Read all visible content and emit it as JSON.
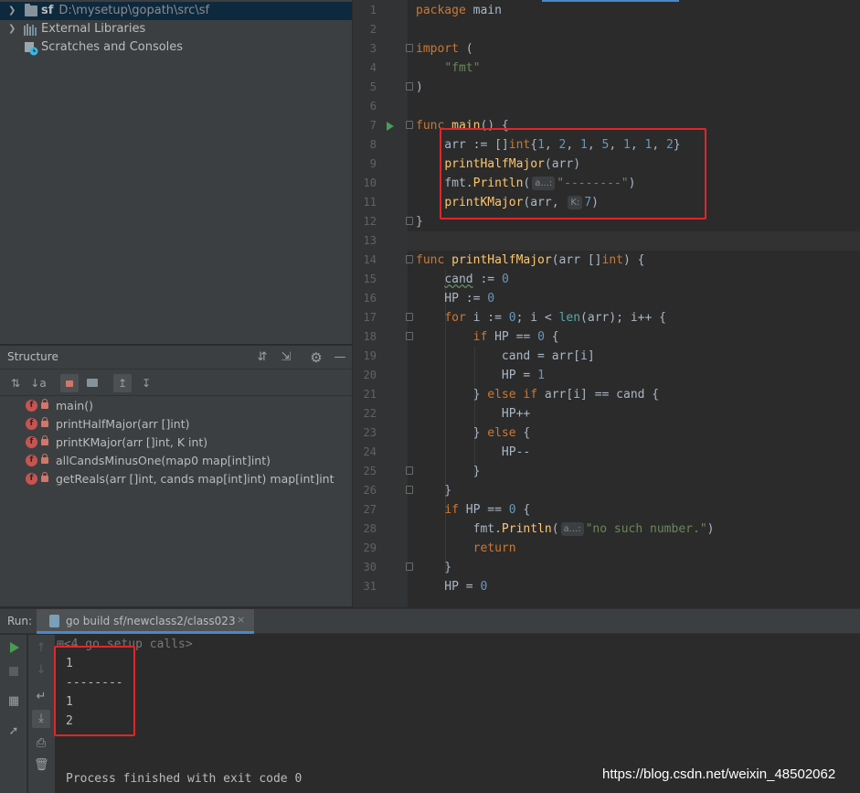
{
  "project_tree": {
    "items": [
      {
        "name": "sf",
        "path": "D:\\mysetup\\gopath\\src\\sf",
        "icon": "folder-icon"
      },
      {
        "name": "External Libraries",
        "icon": "library-icon"
      },
      {
        "name": "Scratches and Consoles",
        "icon": "scratch-icon"
      }
    ]
  },
  "structure": {
    "title": "Structure",
    "items": [
      {
        "label": "main()"
      },
      {
        "label": "printHalfMajor(arr []int)"
      },
      {
        "label": "printKMajor(arr []int, K int)"
      },
      {
        "label": "allCandsMinusOne(map0 map[int]int)"
      },
      {
        "label": "getReals(arr []int, cands map[int]int) map[int]int"
      }
    ],
    "badge": "f"
  },
  "editor": {
    "line_numbers": [
      "1",
      "2",
      "3",
      "4",
      "5",
      "6",
      "7",
      "8",
      "9",
      "10",
      "11",
      "12",
      "13",
      "14",
      "15",
      "16",
      "17",
      "18",
      "19",
      "20",
      "21",
      "22",
      "23",
      "24",
      "25",
      "26",
      "27",
      "28",
      "29",
      "30",
      "31"
    ],
    "hints": {
      "a": "a...:",
      "k": "K:"
    }
  },
  "run": {
    "title": "Run:",
    "tab_label": "go build sf/newclass2/class023",
    "close_glyph": "×",
    "setup_calls": "<4 go setup calls>",
    "output": [
      "1",
      "--------",
      "1",
      "2"
    ],
    "finished": "Process finished with exit code 0"
  },
  "watermark": "https://blog.csdn.net/weixin_48502062",
  "colors": {
    "keyword": "#cc7832",
    "function": "#ffc66d",
    "string": "#6a8759",
    "number": "#6897bb",
    "highlight_box": "#e0262b"
  }
}
